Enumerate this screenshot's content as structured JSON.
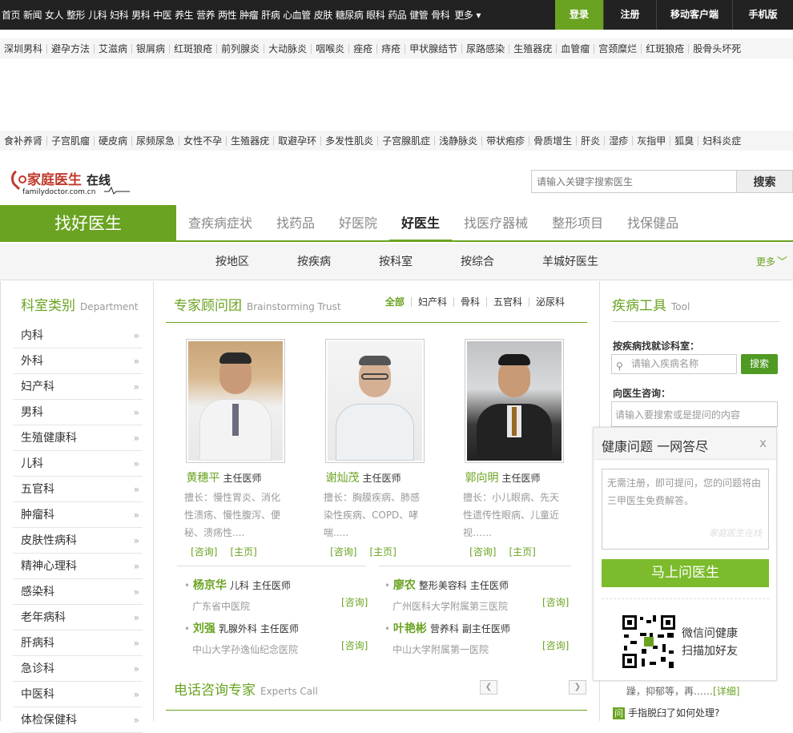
{
  "topnav": {
    "items": [
      "首页",
      "新闻",
      "女人",
      "整形",
      "儿科",
      "妇科",
      "男科",
      "中医",
      "养生",
      "营养",
      "两性",
      "肿瘤",
      "肝病",
      "心血管",
      "皮肤",
      "糖尿病",
      "眼科",
      "药品",
      "健管",
      "骨科"
    ],
    "more_label": "更多",
    "login": "登录",
    "register": "注册",
    "mobile_client": "移动客户端",
    "phone_version": "手机版"
  },
  "keywords_row1": [
    "深圳男科",
    "避孕方法",
    "艾滋病",
    "银屑病",
    "红斑狼疮",
    "前列腺炎",
    "大动脉炎",
    "咽喉炎",
    "痤疮",
    "痔疮",
    "甲状腺结节",
    "尿路感染",
    "生殖器疣",
    "血管瘤",
    "宫颈糜烂",
    "红斑狼疮",
    "股骨头坏死"
  ],
  "keywords_row2": [
    "食补养肾",
    "子宫肌瘤",
    "硬皮病",
    "尿频尿急",
    "女性不孕",
    "生殖器疣",
    "取避孕环",
    "多发性肌炎",
    "子宫腺肌症",
    "浅静脉炎",
    "带状疱疹",
    "骨质增生",
    "肝炎",
    "湿疹",
    "灰指甲",
    "狐臭",
    "妇科炎症"
  ],
  "logo": {
    "text": "家庭医生在线",
    "sub": "familydoctor.com.cn"
  },
  "search": {
    "placeholder": "请输入关键字搜索医生",
    "button": "搜索"
  },
  "mainnav": {
    "brand": "找好医生",
    "tabs": [
      "查疾病症状",
      "找药品",
      "好医院",
      "好医生",
      "找医疗器械",
      "整形项目",
      "找保健品"
    ],
    "active_index": 3
  },
  "subnav": {
    "items": [
      "按地区",
      "按疾病",
      "按科室",
      "按综合",
      "羊城好医生"
    ],
    "more": "更多"
  },
  "sidebar": {
    "title": "科室类别",
    "title_en": "Department",
    "items": [
      "内科",
      "外科",
      "妇产科",
      "男科",
      "生殖健康科",
      "儿科",
      "五官科",
      "肿瘤科",
      "皮肤性病科",
      "精神心理科",
      "感染科",
      "老年病科",
      "肝病科",
      "急诊科",
      "中医科",
      "体检保健科"
    ]
  },
  "experts": {
    "title": "专家顾问团",
    "title_en": "Brainstorming Trust",
    "filters": [
      "全部",
      "妇产科",
      "骨科",
      "五官科",
      "泌尿科"
    ],
    "doctors": [
      {
        "name": "黄穗平",
        "title": "主任医师",
        "specialty": "擅长：慢性胃炎、消化性溃疡、慢性腹泻、便秘、溃疡性....",
        "consult": "[咨询]",
        "home": "[主页]"
      },
      {
        "name": "谢灿茂",
        "title": "主任医师",
        "specialty": "擅长：胸膜疾病、肺感染性疾病、COPD、哮喘.....",
        "consult": "[咨询]",
        "home": "[主页]"
      },
      {
        "name": "郭向明",
        "title": "主任医师",
        "specialty": "擅长：小儿眼病、先天性遗传性眼病、儿童近视……",
        "consult": "[咨询]",
        "home": "[主页]"
      }
    ],
    "more_doctors": [
      {
        "name": "杨京华",
        "dept": "儿科",
        "title": "主任医师",
        "hospital": "广东省中医院",
        "ask": "[咨询]"
      },
      {
        "name": "廖农",
        "dept": "整形美容科",
        "title": "主任医师",
        "hospital": "广州医科大学附属第三医院",
        "ask": "[咨询]"
      },
      {
        "name": "刘强",
        "dept": "乳腺外科",
        "title": "主任医师",
        "hospital": "中山大学孙逸仙纪念医院",
        "ask": "[咨询]"
      },
      {
        "name": "叶艳彬",
        "dept": "营养科",
        "title": "副主任医师",
        "hospital": "中山大学附属第一医院",
        "ask": "[咨询]"
      }
    ]
  },
  "phone_experts": {
    "title": "电话咨询专家",
    "title_en": "Experts Call"
  },
  "tools": {
    "title": "疾病工具",
    "title_en": "Tool",
    "disease_label": "按疾病找就诊科室：",
    "disease_placeholder": "请输入疾病名称",
    "disease_btn": "搜索",
    "ask_label": "向医生咨询：",
    "ask_placeholder": "请输入要搜索或是提问的内容"
  },
  "popup": {
    "title": "健康问题  一网答尽",
    "close": "x",
    "textarea": "无需注册，即可提问，您的问题将由三甲医生免费解答。",
    "watermark": "家庭医生在线",
    "button": "马上问医生",
    "wechat_line1": "微信问健康",
    "wechat_line2": "扫描加好友"
  },
  "right_bottom": {
    "snippet": "躁，抑郁等，再……",
    "detail": "[详细]",
    "question_icon": "问",
    "question": "手指脱臼了如何处理?"
  },
  "colors": {
    "green": "#6aa321",
    "dark": "#222222"
  }
}
